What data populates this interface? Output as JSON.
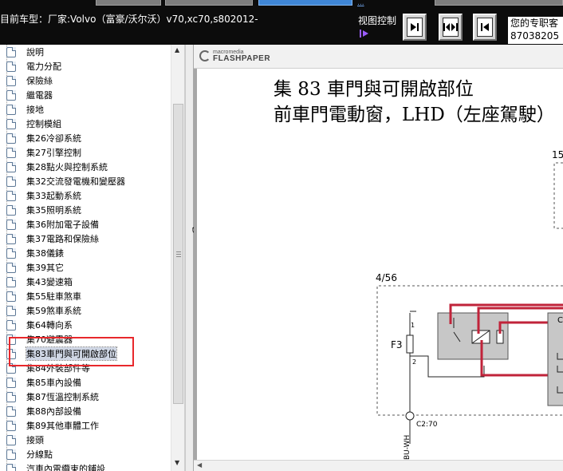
{
  "toolbar": {
    "vehicle_label": "目前车型：厂家:Volvo（富豪/沃尔沃）v70,xc70,s802012-",
    "view_control_label": "视图控制",
    "view_buttons": [
      "next-page",
      "fit-width",
      "previous-page"
    ],
    "top_link": "..."
  },
  "contact": {
    "line1": "您的专职客",
    "line2": "87038205"
  },
  "tree": {
    "items": [
      {
        "label": "說明"
      },
      {
        "label": "電力分配"
      },
      {
        "label": "保險絲"
      },
      {
        "label": "繼電器"
      },
      {
        "label": "接地"
      },
      {
        "label": "控制模組"
      },
      {
        "label": "集26冷卻系統"
      },
      {
        "label": "集27引擎控制"
      },
      {
        "label": "集28點火與控制系統"
      },
      {
        "label": "集32交流發電機和變壓器"
      },
      {
        "label": "集33起動系統"
      },
      {
        "label": "集35照明系統"
      },
      {
        "label": "集36附加電子設備"
      },
      {
        "label": "集37電路和保險絲"
      },
      {
        "label": "集38儀錶"
      },
      {
        "label": "集39其它"
      },
      {
        "label": "集43變速箱"
      },
      {
        "label": "集55駐車煞車"
      },
      {
        "label": "集59煞車系統"
      },
      {
        "label": "集64轉向系"
      },
      {
        "label": "集70避震器"
      },
      {
        "label": "集83車門與可開啟部位",
        "selected": true
      },
      {
        "label": "集84外裝部件等"
      },
      {
        "label": "集85車內設備"
      },
      {
        "label": "集87恆溫控制系統"
      },
      {
        "label": "集88內部設備"
      },
      {
        "label": "集89其他車體工作"
      },
      {
        "label": "接頭"
      },
      {
        "label": "分線點"
      },
      {
        "label": "汽車內電纜束的鋪設"
      }
    ]
  },
  "viewer": {
    "logo_small": "macromedia",
    "logo_big": "FLASHPAPER",
    "page_title_line1": "集 83 車門與可開啟部位",
    "page_title_line2": "前車門電動窗，LHD（左座駕駛）",
    "diagram_labels": {
      "ref_top": "15",
      "ref_box": "4/56",
      "fuse": "F3",
      "pin1": "1",
      "pin2": "2",
      "connector": "C2:70",
      "wire": "BU-WH",
      "side": "C"
    }
  },
  "colors": {
    "toolbar_bg": "#0c0c0c",
    "accent_blue": "#3f86d6",
    "highlight_red": "#e8282c",
    "wire_red": "#c0233a",
    "relay_gray": "#c7c7c7"
  }
}
